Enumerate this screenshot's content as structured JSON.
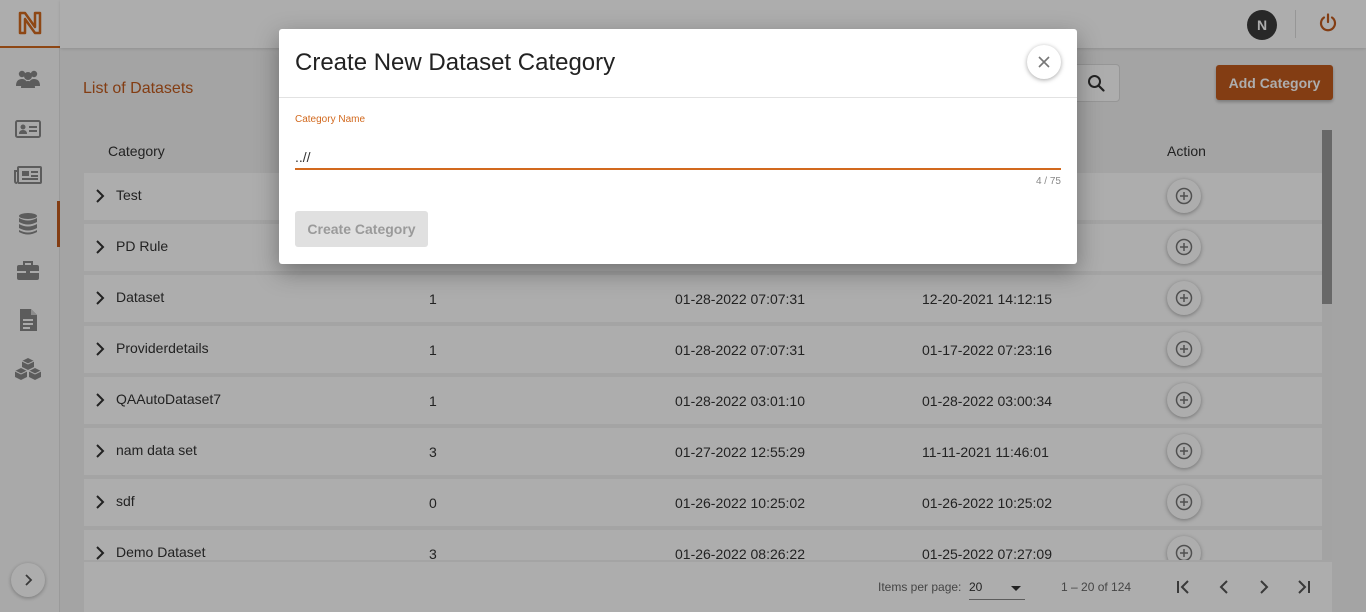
{
  "sidebar": {
    "logo_icon": "n-logo",
    "items": [
      {
        "icon": "users-icon"
      },
      {
        "icon": "id-card-icon"
      },
      {
        "icon": "newspaper-icon"
      },
      {
        "icon": "database-icon",
        "active": true
      },
      {
        "icon": "briefcase-icon"
      },
      {
        "icon": "document-icon"
      },
      {
        "icon": "cubes-icon"
      }
    ],
    "expand_icon": "chevron-right-icon"
  },
  "topbar": {
    "avatar_initial": "N",
    "power_icon": "power-icon"
  },
  "main": {
    "title": "List of Datasets",
    "add_button": "Add Category",
    "search_icon": "search-icon"
  },
  "table": {
    "headers": {
      "category": "Category",
      "action": "Action"
    },
    "rows": [
      {
        "category": "Test",
        "count": "",
        "modified": "",
        "created": ""
      },
      {
        "category": "PD Rule",
        "count": "",
        "modified": "",
        "created": ""
      },
      {
        "category": "Dataset",
        "count": "1",
        "modified": "01-28-2022 07:07:31",
        "created": "12-20-2021 14:12:15"
      },
      {
        "category": "Providerdetails",
        "count": "1",
        "modified": "01-28-2022 07:07:31",
        "created": "01-17-2022 07:23:16"
      },
      {
        "category": "QAAutoDataset7",
        "count": "1",
        "modified": "01-28-2022 03:01:10",
        "created": "01-28-2022 03:00:34"
      },
      {
        "category": "nam data set",
        "count": "3",
        "modified": "01-27-2022 12:55:29",
        "created": "11-11-2021 11:46:01"
      },
      {
        "category": "sdf",
        "count": "0",
        "modified": "01-26-2022 10:25:02",
        "created": "01-26-2022 10:25:02"
      },
      {
        "category": "Demo Dataset",
        "count": "3",
        "modified": "01-26-2022 08:26:22",
        "created": "01-25-2022 07:27:09"
      }
    ]
  },
  "paginator": {
    "items_per_page_label": "Items per page:",
    "page_size": "20",
    "range": "1 – 20 of 124"
  },
  "dialog": {
    "title": "Create New Dataset Category",
    "field_label": "Category Name",
    "field_value": "..//",
    "field_hint": "4 / 75",
    "create_button": "Create Category"
  },
  "colors": {
    "accent": "#c25a1d",
    "field_accent": "#d2691e"
  }
}
